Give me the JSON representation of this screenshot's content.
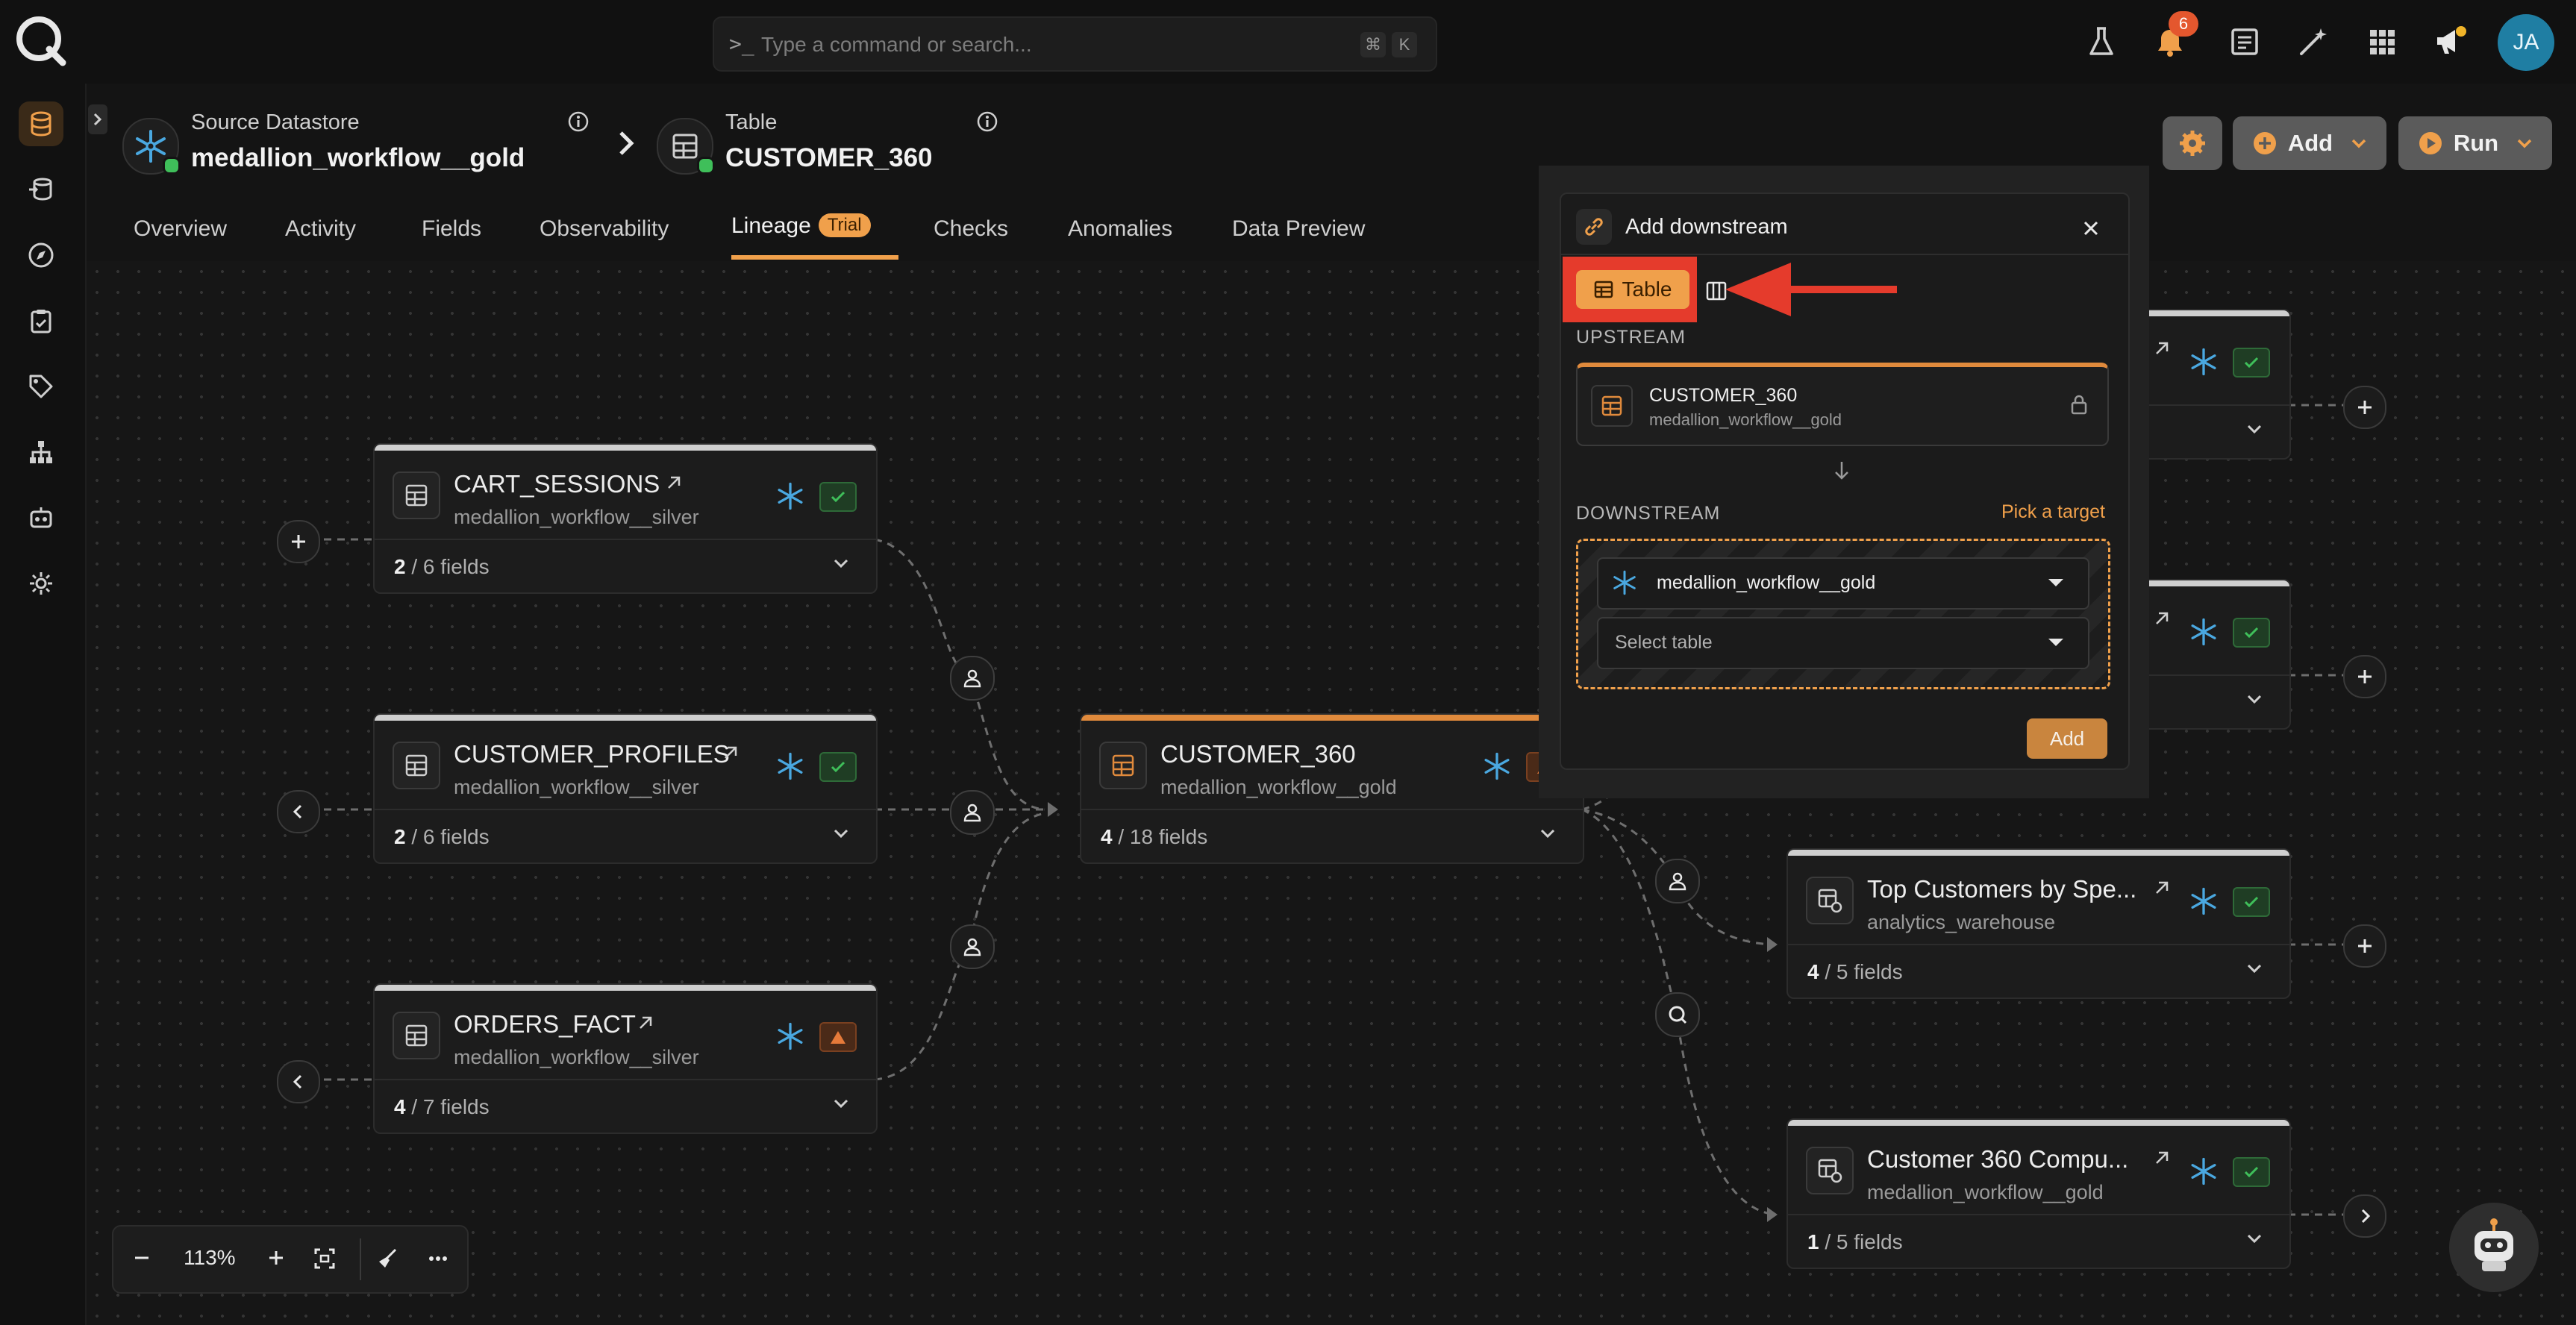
{
  "app": {
    "search_placeholder": "Type a command or search...",
    "kbd_cmd": "⌘",
    "kbd_k": "K",
    "notification_count": "6",
    "avatar_initials": "JA"
  },
  "header": {
    "source_label": "Source Datastore",
    "source_name": "medallion_workflow__gold",
    "table_label": "Table",
    "table_name": "CUSTOMER_360",
    "add_button": "Add",
    "run_button": "Run"
  },
  "tabs": [
    {
      "label": "Overview"
    },
    {
      "label": "Activity"
    },
    {
      "label": "Fields"
    },
    {
      "label": "Observability"
    },
    {
      "label": "Lineage",
      "badge": "Trial"
    },
    {
      "label": "Checks"
    },
    {
      "label": "Anomalies"
    },
    {
      "label": "Data Preview"
    }
  ],
  "nodes": {
    "cart_sessions": {
      "title": "CART_SESSIONS",
      "sub": "medallion_workflow__silver",
      "fields_count": "2",
      "fields_total": " / 6 fields"
    },
    "customer_profiles": {
      "title": "CUSTOMER_PROFILES",
      "sub": "medallion_workflow__silver",
      "fields_count": "2",
      "fields_total": " / 6 fields"
    },
    "orders_fact": {
      "title": "ORDERS_FACT",
      "sub": "medallion_workflow__silver",
      "fields_count": "4",
      "fields_total": " / 7 fields"
    },
    "customer_360": {
      "title": "CUSTOMER_360",
      "sub": "medallion_workflow__gold",
      "fields_count": "4",
      "fields_total": " / 18 fields"
    },
    "top_customers": {
      "title": "Top Customers by Spe...",
      "sub": "analytics_warehouse",
      "fields_count": "4",
      "fields_total": " / 5 fields"
    },
    "customer_360_compu": {
      "title": "Customer 360 Compu...",
      "sub": "medallion_workflow__gold",
      "fields_count": "1",
      "fields_total": " / 5 fields"
    }
  },
  "modal": {
    "title": "Add downstream",
    "type_table": "Table",
    "upstream_label": "UPSTREAM",
    "upstream_name": "CUSTOMER_360",
    "upstream_sub": "medallion_workflow__gold",
    "downstream_label": "DOWNSTREAM",
    "pick_target": "Pick a target",
    "datastore_value": "medallion_workflow__gold",
    "table_placeholder": "Select table",
    "add_button": "Add"
  },
  "zoom": {
    "level": "113%"
  },
  "colors": {
    "accent": "#f0a04b",
    "highlight_red": "#e53b2c",
    "check_green": "#3fbf5a",
    "snowflake_blue": "#4aa8e0"
  }
}
